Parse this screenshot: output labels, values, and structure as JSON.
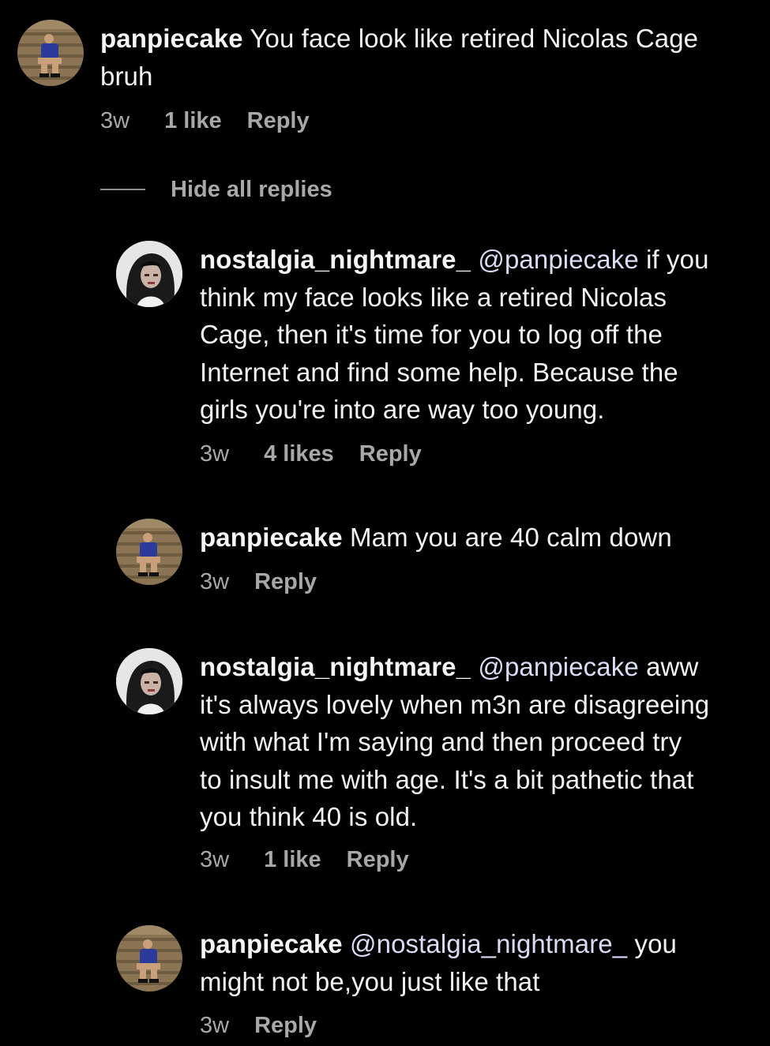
{
  "colors": {
    "background": "#000000",
    "text": "#f2f2f2",
    "meta": "#a8a8a8",
    "mention": "#d8dcf5"
  },
  "thread": {
    "parent": {
      "username": "panpiecake",
      "text_line1": "You face look like retired Nicolas Cage",
      "text_line2": "bruh",
      "time": "3w",
      "likes": "1 like",
      "reply": "Reply",
      "avatar_icon": "avatar-panpiecake"
    },
    "hide_replies": "Hide all replies",
    "replies": [
      {
        "username": "nostalgia_nightmare_",
        "mention": "@panpiecake",
        "lines": [
          "if you",
          "think my face looks like a retired Nicolas",
          "Cage, then it's time for you to log off the",
          "Internet and find some help. Because the",
          "girls you're into are way too young."
        ],
        "time": "3w",
        "likes": "4 likes",
        "reply": "Reply",
        "avatar_icon": "avatar-nostalgia"
      },
      {
        "username": "panpiecake",
        "lines": [
          "Mam you are 40 calm down"
        ],
        "time": "3w",
        "reply": "Reply",
        "avatar_icon": "avatar-panpiecake"
      },
      {
        "username": "nostalgia_nightmare_",
        "mention": "@panpiecake",
        "lines": [
          "aww",
          "it's always lovely when m3n are disagreeing",
          "with what I'm saying and then proceed try",
          "to insult me with age. It's a bit pathetic that",
          "you think 40 is old."
        ],
        "time": "3w",
        "likes": "1 like",
        "reply": "Reply",
        "avatar_icon": "avatar-nostalgia"
      },
      {
        "username": "panpiecake",
        "mention": "@nostalgia_nightmare_",
        "lines": [
          "you",
          "might not be,you just like that"
        ],
        "time": "3w",
        "reply": "Reply",
        "avatar_icon": "avatar-panpiecake"
      }
    ]
  }
}
